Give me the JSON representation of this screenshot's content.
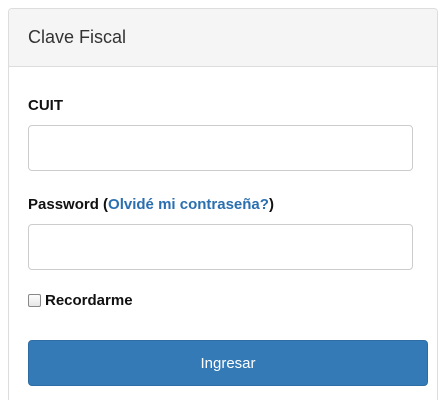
{
  "panel": {
    "title": "Clave Fiscal"
  },
  "form": {
    "cuit_label": "CUIT",
    "cuit_value": "",
    "password_label": "Password",
    "forgot_open": " (",
    "forgot_link": "Olvidé mi contraseña?",
    "forgot_close": ")",
    "password_value": "",
    "remember_label": "Recordarme",
    "remember_checked": false,
    "submit_label": "Ingresar"
  },
  "colors": {
    "primary": "#337ab7",
    "link": "#2a6fb0",
    "heading_bg": "#f5f5f5"
  }
}
